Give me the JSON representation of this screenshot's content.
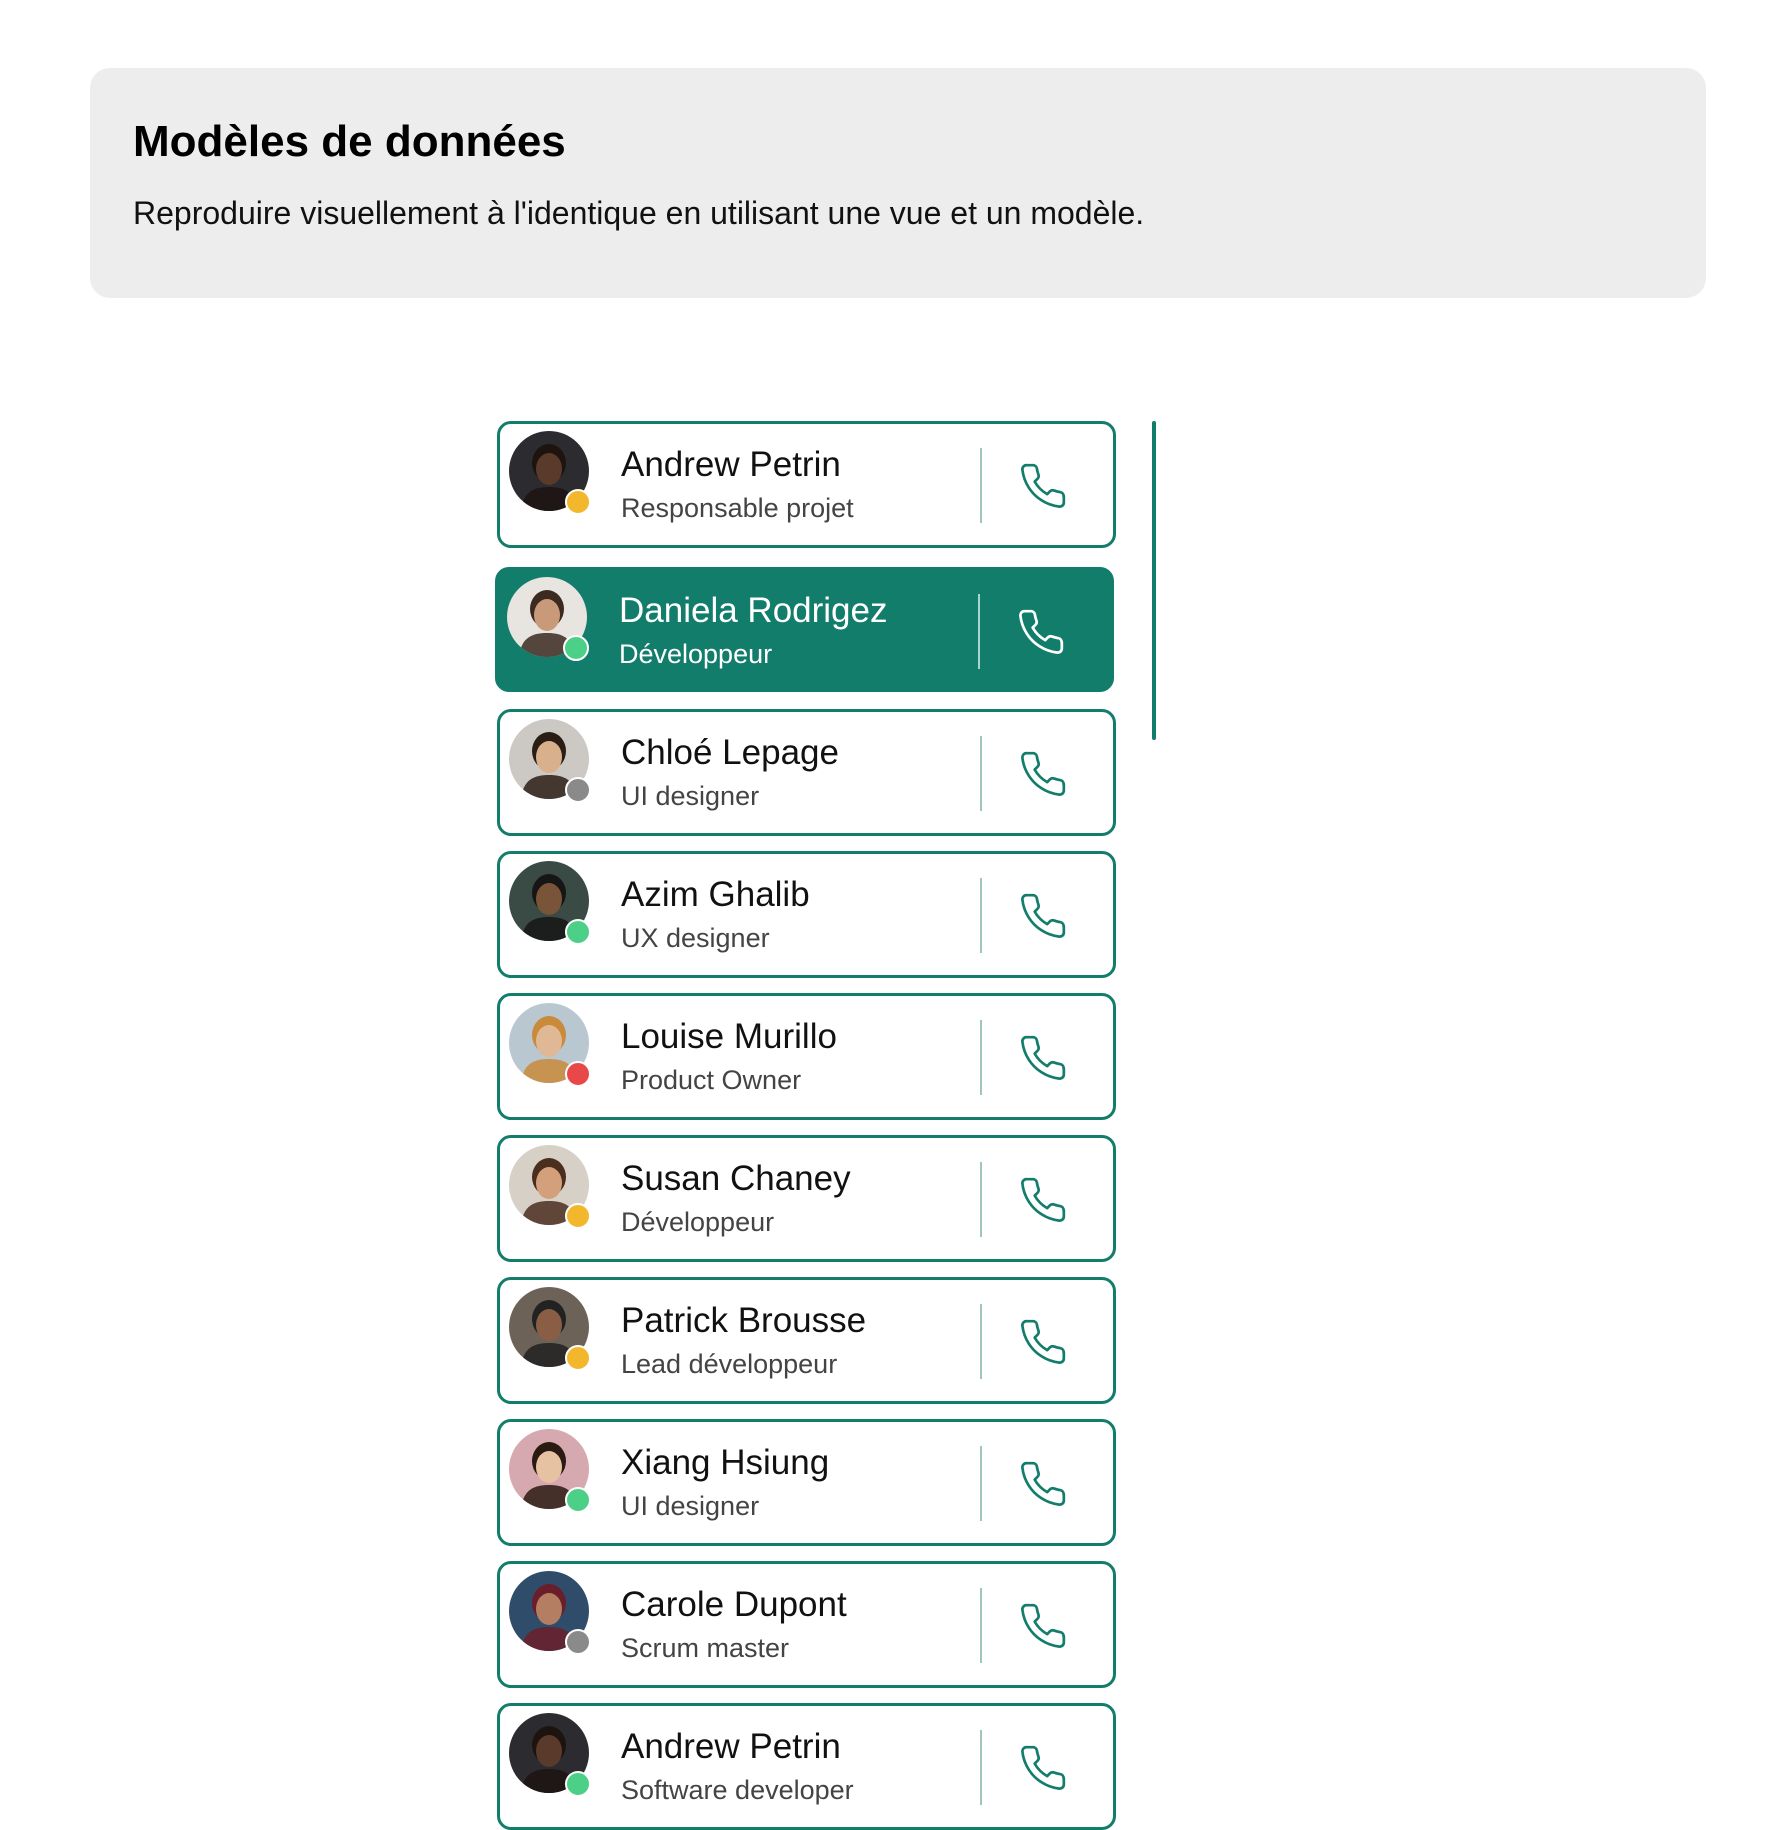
{
  "header": {
    "title": "Modèles de données",
    "description": "Reproduire visuellement à l'identique en utilisant une vue et un modèle."
  },
  "colors": {
    "accent": "#137d6c",
    "status_away": "#f3b72e",
    "status_online": "#4ccf86",
    "status_offline": "#8a8a8a",
    "status_busy": "#e84848"
  },
  "contacts": [
    {
      "name": "Andrew Petrin",
      "role": "Responsable projet",
      "status": "away",
      "avatar": "avatar-photo",
      "selected": false
    },
    {
      "name": "Daniela Rodrigez",
      "role": "Développeur",
      "status": "online",
      "avatar": "avatar-photo",
      "selected": true
    },
    {
      "name": "Chloé Lepage",
      "role": "UI designer",
      "status": "offline",
      "avatar": "avatar-photo",
      "selected": false
    },
    {
      "name": "Azim Ghalib",
      "role": "UX designer",
      "status": "online",
      "avatar": "avatar-photo",
      "selected": false
    },
    {
      "name": "Louise Murillo",
      "role": "Product Owner",
      "status": "busy",
      "avatar": "avatar-photo",
      "selected": false
    },
    {
      "name": "Susan Chaney",
      "role": "Développeur",
      "status": "away",
      "avatar": "avatar-photo",
      "selected": false
    },
    {
      "name": "Patrick Brousse",
      "role": "Lead développeur",
      "status": "away",
      "avatar": "avatar-photo",
      "selected": false
    },
    {
      "name": "Xiang Hsiung",
      "role": "UI designer",
      "status": "online",
      "avatar": "avatar-photo",
      "selected": false
    },
    {
      "name": "Carole Dupont",
      "role": "Scrum master",
      "status": "offline",
      "avatar": "avatar-photo",
      "selected": false
    },
    {
      "name": "Andrew Petrin",
      "role": "Software developer",
      "status": "online",
      "avatar": "avatar-photo",
      "selected": false
    }
  ],
  "call_icon": "phone-icon"
}
